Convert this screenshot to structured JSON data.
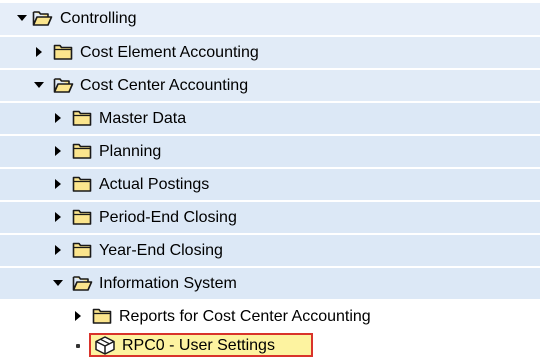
{
  "colors": {
    "row_bg_level0": "#e6eef9",
    "row_bg_level1": "#e1ebf7",
    "row_bg_level2": "#dce8f6",
    "row_bg_level3": "#ffffff",
    "folder_fill": "#fbe58d",
    "folder_stroke": "#1a1a1a",
    "highlight_fill": "#fdf3a0",
    "highlight_border": "#d9332b"
  },
  "tree": {
    "rows": [
      {
        "label": "Controlling",
        "state": "expanded",
        "icon": "folder-open-icon"
      },
      {
        "label": "Cost Element Accounting",
        "state": "collapsed",
        "icon": "folder-icon"
      },
      {
        "label": "Cost Center Accounting",
        "state": "expanded",
        "icon": "folder-open-icon"
      },
      {
        "label": "Master Data",
        "state": "collapsed",
        "icon": "folder-icon"
      },
      {
        "label": "Planning",
        "state": "collapsed",
        "icon": "folder-icon"
      },
      {
        "label": "Actual Postings",
        "state": "collapsed",
        "icon": "folder-icon"
      },
      {
        "label": "Period-End Closing",
        "state": "collapsed",
        "icon": "folder-icon"
      },
      {
        "label": "Year-End Closing",
        "state": "collapsed",
        "icon": "folder-icon"
      },
      {
        "label": "Information System",
        "state": "expanded",
        "icon": "folder-open-icon"
      },
      {
        "label": "Reports for Cost Center Accounting",
        "state": "collapsed",
        "icon": "folder-icon"
      },
      {
        "label": "RPC0 - User Settings",
        "state": "leaf",
        "icon": "transaction-cube-icon",
        "selected": true
      }
    ]
  }
}
